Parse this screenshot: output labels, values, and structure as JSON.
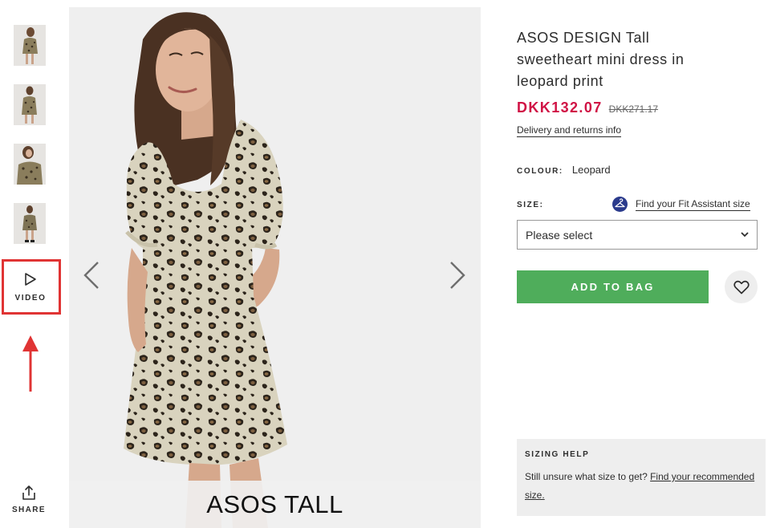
{
  "thumbnails": [
    {
      "alt": "product-thumbnail-1"
    },
    {
      "alt": "product-thumbnail-2"
    },
    {
      "alt": "product-thumbnail-3"
    },
    {
      "alt": "product-thumbnail-4"
    }
  ],
  "gallery": {
    "video_label": "VIDEO",
    "share_label": "SHARE",
    "brand_banner": "ASOS TALL"
  },
  "product": {
    "title": "ASOS DESIGN Tall sweetheart mini dress in leopard print",
    "price_now": "DKK132.07",
    "price_was": "DKK271.17",
    "delivery_link": "Delivery and returns info",
    "colour_label": "COLOUR:",
    "colour_value": "Leopard",
    "size_label": "SIZE:",
    "fit_assistant_link": "Find your Fit Assistant size",
    "size_select_placeholder": "Please select",
    "add_to_bag_label": "ADD TO BAG"
  },
  "sizing_help": {
    "heading": "SIZING HELP",
    "text": "Still unsure what size to get?",
    "link": "Find your recommended size."
  },
  "colors": {
    "price_red": "#d01345",
    "button_green": "#4fad5b",
    "annotation_red": "#e03434",
    "panel_grey": "#eeeeee"
  },
  "icons": [
    "play-icon",
    "share-icon",
    "chevron-left-icon",
    "chevron-right-icon",
    "hanger-icon",
    "chevron-down-icon",
    "heart-icon",
    "red-arrow-annotation"
  ]
}
